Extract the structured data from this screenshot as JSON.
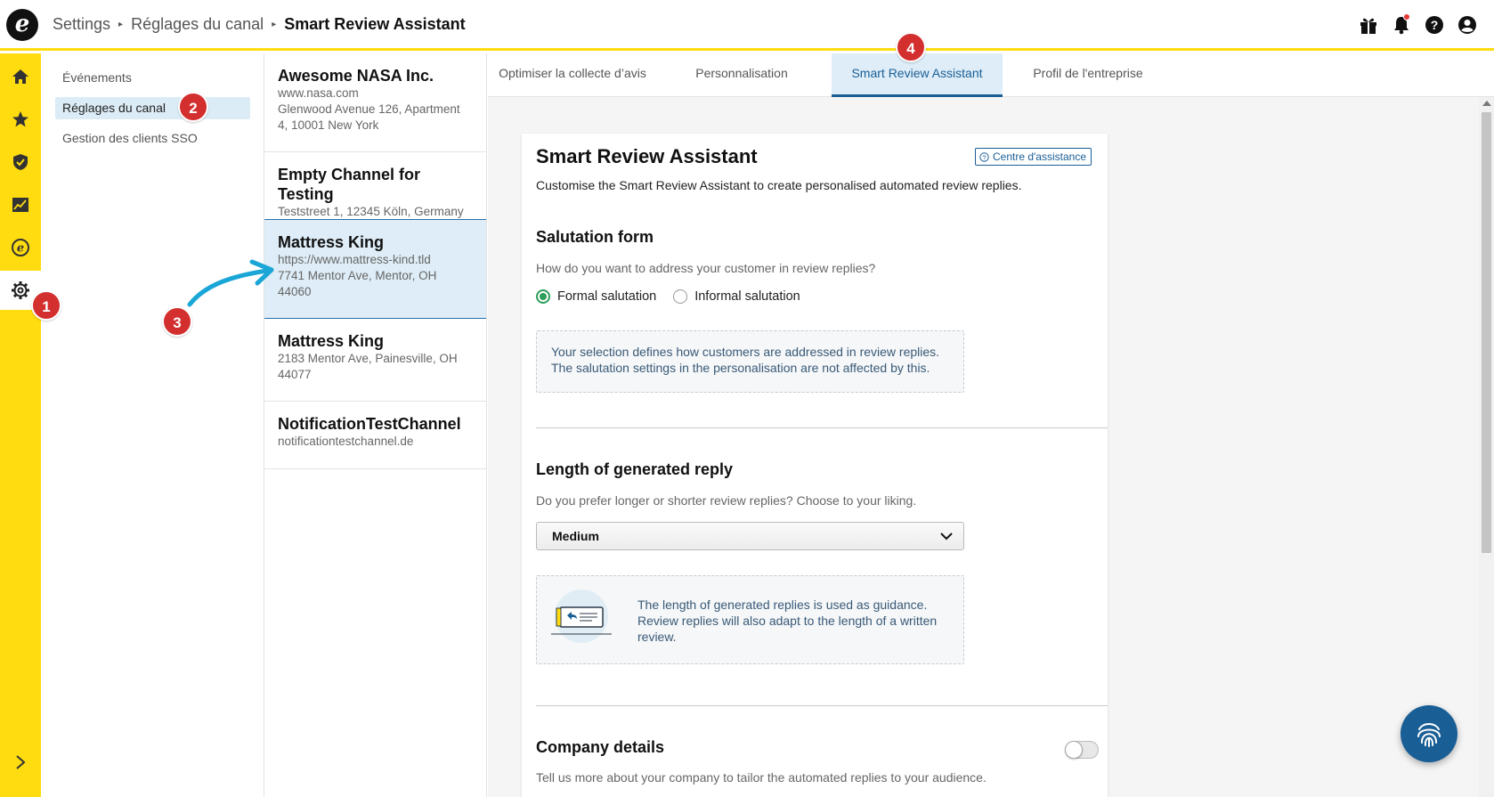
{
  "breadcrumb": {
    "root": "Settings",
    "middle": "Réglages du canal",
    "current": "Smart Review Assistant"
  },
  "topbar_icons": [
    "gift-icon",
    "bell-icon",
    "help-icon",
    "account-icon"
  ],
  "rail": {
    "items": [
      "home-icon",
      "star-icon",
      "shield-check-icon",
      "analytics-icon",
      "etrusted-icon",
      "settings-gear-icon"
    ],
    "active": "settings-gear-icon",
    "expand_icon": "chevron-right-icon"
  },
  "subnav": {
    "items": [
      {
        "label": "Événements"
      },
      {
        "label": "Réglages du canal",
        "active": true
      },
      {
        "label": "Gestion des clients SSO"
      }
    ]
  },
  "channels": [
    {
      "name": "Awesome NASA Inc.",
      "lines": [
        "www.nasa.com",
        "Glenwood Avenue 126, Apartment",
        "4, 10001 New York"
      ]
    },
    {
      "name": "Empty Channel for Testing",
      "lines": [
        "Teststreet 1, 12345 Köln, Germany"
      ]
    },
    {
      "name": "Mattress King",
      "lines": [
        "https://www.mattress-kind.tld",
        "7741 Mentor Ave, Mentor, OH",
        "44060"
      ],
      "active": true
    },
    {
      "name": "Mattress King",
      "lines": [
        "2183 Mentor Ave, Painesville, OH",
        "44077"
      ]
    },
    {
      "name": "NotificationTestChannel",
      "lines": [
        "notificationtestchannel.de"
      ]
    }
  ],
  "tabs": [
    {
      "label": "Optimiser la collecte d’avis"
    },
    {
      "label": "Personnalisation"
    },
    {
      "label": "Smart Review Assistant",
      "active": true
    },
    {
      "label": "Profil de l'entreprise"
    }
  ],
  "card": {
    "title": "Smart Review Assistant",
    "help_link": "Centre d'assistance",
    "subtitle": "Customise the Smart Review Assistant to create personalised automated review replies.",
    "salutation": {
      "title": "Salutation form",
      "question": "How do you want to address your customer in review replies?",
      "options": [
        "Formal salutation",
        "Informal salutation"
      ],
      "selected": "Formal salutation",
      "info_lines": [
        "Your selection defines how customers are addressed in review replies.",
        "The salutation settings in the personalisation are not affected by this."
      ]
    },
    "length": {
      "title": "Length of generated reply",
      "question": "Do you prefer longer or shorter review replies? Choose to your liking.",
      "selected": "Medium",
      "info_lines": [
        "The length of generated replies is used as guidance.",
        "Review replies will also adapt to the length of a written",
        "review."
      ]
    },
    "company": {
      "title": "Company details",
      "question": "Tell us more about your company to tailor the automated replies to your audience.",
      "toggle_on": false
    }
  },
  "annotations": [
    "1",
    "2",
    "3",
    "4"
  ],
  "colors": {
    "brand_yellow": "#ffdc0f",
    "accent_blue": "#1a5e96",
    "active_bg": "#deedf7",
    "radio_green": "#2e9e5b",
    "badge_red": "#d32f2f",
    "arrow_cyan": "#1aa6d6"
  }
}
